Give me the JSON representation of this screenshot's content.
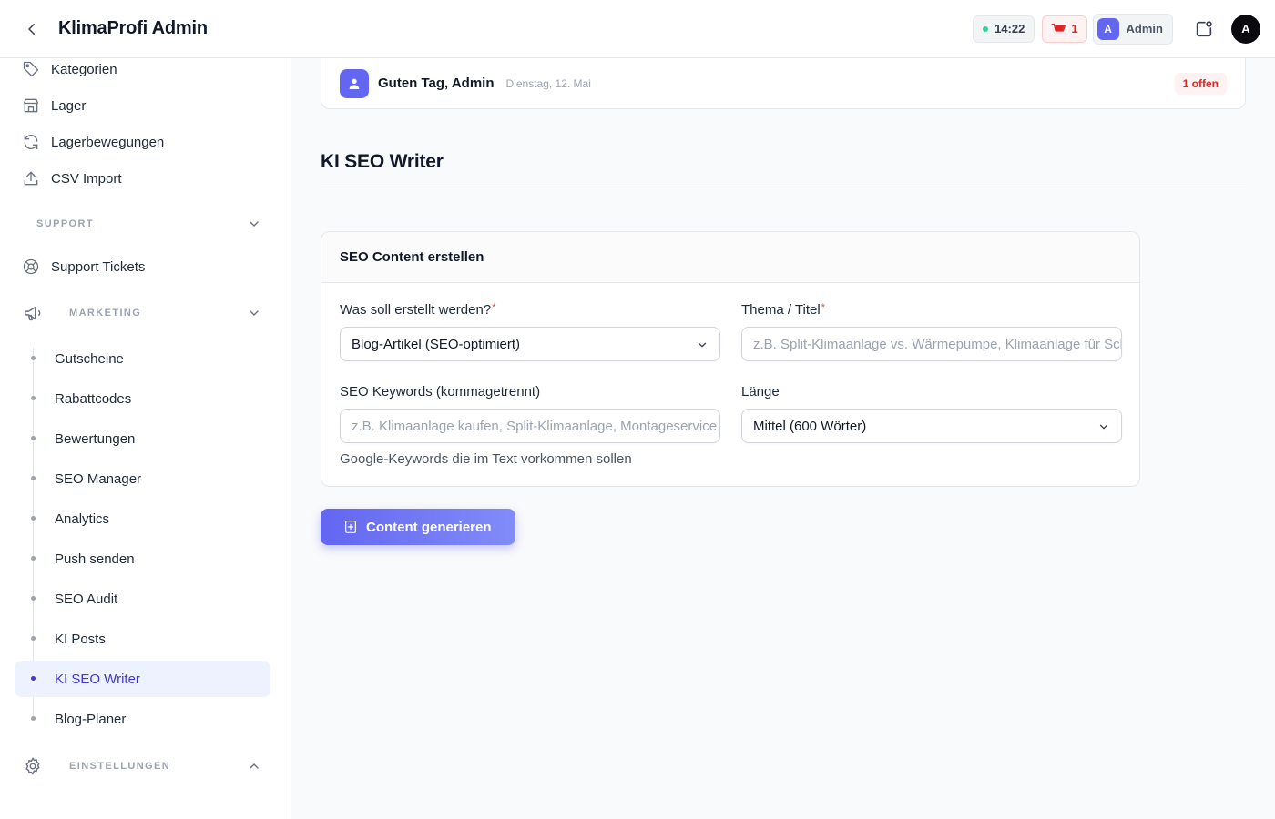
{
  "app": {
    "title": "KlimaProfi Admin"
  },
  "header": {
    "time": "14:22",
    "cart_count": "1",
    "user_initial": "A",
    "user_name": "Admin",
    "avatar_initial": "A"
  },
  "sidebar": {
    "top_items": [
      {
        "label": "Kategorien",
        "icon": "tag-icon"
      },
      {
        "label": "Lager",
        "icon": "warehouse-icon"
      },
      {
        "label": "Lagerbewegungen",
        "icon": "refresh-icon"
      },
      {
        "label": "CSV Import",
        "icon": "upload-icon"
      }
    ],
    "support_header": "SUPPORT",
    "support_items": [
      {
        "label": "Support Tickets",
        "icon": "lifebuoy-icon"
      }
    ],
    "marketing_header": "MARKETING",
    "marketing_items": [
      {
        "label": "Gutscheine"
      },
      {
        "label": "Rabattcodes"
      },
      {
        "label": "Bewertungen"
      },
      {
        "label": "SEO Manager"
      },
      {
        "label": "Analytics"
      },
      {
        "label": "Push senden"
      },
      {
        "label": "SEO Audit"
      },
      {
        "label": "KI Posts"
      },
      {
        "label": "KI SEO Writer",
        "active": true
      },
      {
        "label": "Blog-Planer"
      }
    ],
    "settings_header": "EINSTELLUNGEN"
  },
  "greeting": {
    "text": "Guten Tag, Admin",
    "date": "Dienstag, 12. Mai",
    "badge": "1 offen"
  },
  "page": {
    "title": "KI SEO Writer"
  },
  "form": {
    "card_title": "SEO Content erstellen",
    "type_label": "Was soll erstellt werden?",
    "type_value": "Blog-Artikel (SEO-optimiert)",
    "topic_label": "Thema / Titel",
    "topic_placeholder": "z.B. Split-Klimaanlage vs. Wärmepumpe, Klimaanlage für Schlafzimmer",
    "keywords_label": "SEO Keywords (kommagetrennt)",
    "keywords_placeholder": "z.B. Klimaanlage kaufen, Split-Klimaanlage, Montageservice",
    "keywords_help": "Google-Keywords die im Text vorkommen sollen",
    "length_label": "Länge",
    "length_value": "Mittel (600 Wörter)",
    "required_mark": "*"
  },
  "actions": {
    "generate_label": "Content generieren"
  },
  "colors": {
    "accent": "#6366f1",
    "active_text": "#4338ca",
    "danger": "#dc2626"
  }
}
